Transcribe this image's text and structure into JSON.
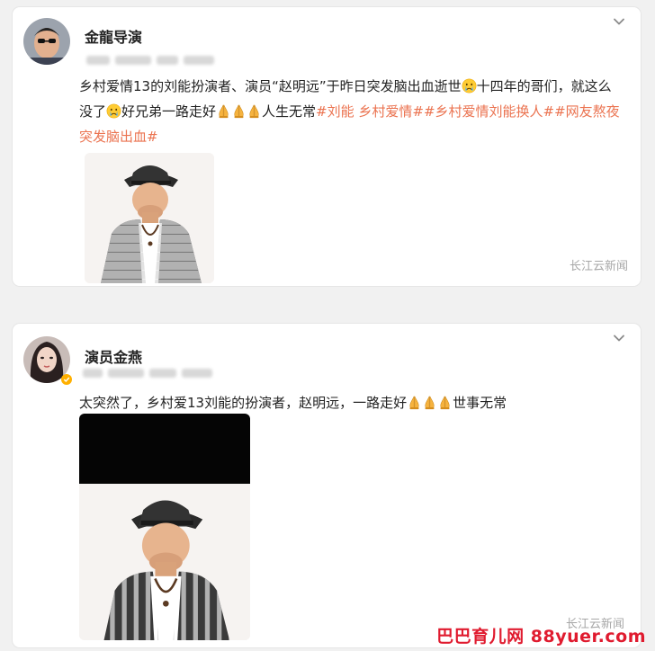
{
  "posts": [
    {
      "username": "金龍导演",
      "text_a": "乡村爱情13的刘能扮演者、演员“赵明远”于昨日突发脑出血逝世",
      "text_b": "十四年的哥们，就这么没了",
      "text_c": "好兄弟一路走好",
      "text_d": "人生无常",
      "tag_1": "#刘能 乡村爱情#",
      "tag_2": "#乡村爱情刘能换人#",
      "tag_3": "#网友熬夜突发脑出血#",
      "watermark": "长江云新闻"
    },
    {
      "username": "演员金燕",
      "text_a": "太突然了，乡村爱13刘能的扮演者，赵明远，一路走好",
      "text_b": "世事无常",
      "watermark": "长江云新闻"
    }
  ],
  "site_watermark": "巴巴育儿网 88yuer.com",
  "icons": {
    "cry": "crying-emoji-icon",
    "pray": "praying-hands-icon",
    "chevron": "chevron-down-icon",
    "verified": "verified-badge-icon"
  },
  "colors": {
    "tag": "#eb7350",
    "site_watermark": "#e01b2f"
  }
}
